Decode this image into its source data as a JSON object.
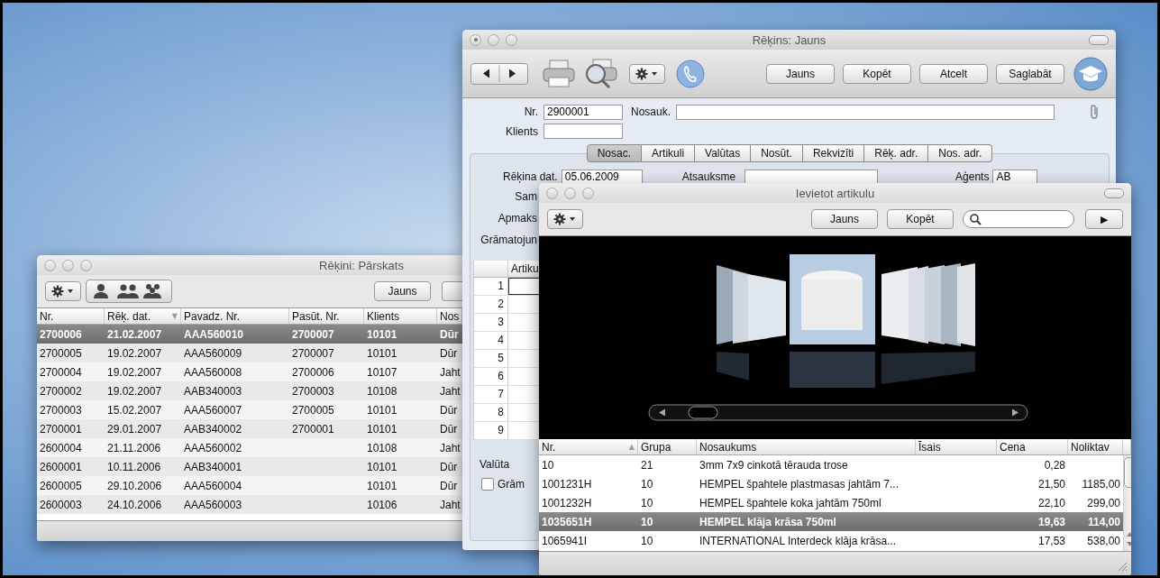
{
  "overview_window": {
    "title": "Rēķini: Pārskats",
    "buttons": [
      "Jauns"
    ],
    "columns": [
      {
        "label": "Nr."
      },
      {
        "label": "Rēķ. dat.",
        "sort_arrow": "▼"
      },
      {
        "label": "Pavadz. Nr."
      },
      {
        "label": "Pasūt. Nr."
      },
      {
        "label": "Klients"
      },
      {
        "label": "Nos"
      }
    ],
    "rows": [
      {
        "selected": true,
        "cells": [
          "2700006",
          "21.02.2007",
          "AAA560010",
          "2700007",
          "10101",
          "Dūr"
        ]
      },
      {
        "selected": false,
        "cells": [
          "2700005",
          "19.02.2007",
          "AAA560009",
          "2700007",
          "10101",
          "Dūr"
        ]
      },
      {
        "selected": false,
        "cells": [
          "2700004",
          "19.02.2007",
          "AAA560008",
          "2700006",
          "10107",
          "Jaht"
        ]
      },
      {
        "selected": false,
        "cells": [
          "2700002",
          "19.02.2007",
          "AAB340003",
          "2700003",
          "10108",
          "Jaht"
        ]
      },
      {
        "selected": false,
        "cells": [
          "2700003",
          "15.02.2007",
          "AAA560007",
          "2700005",
          "10101",
          "Dūr"
        ]
      },
      {
        "selected": false,
        "cells": [
          "2700001",
          "29.01.2007",
          "AAB340002",
          "2700001",
          "10101",
          "Dūr"
        ]
      },
      {
        "selected": false,
        "cells": [
          "2600004",
          "21.11.2006",
          "AAA560002",
          null,
          "10108",
          "Jaht"
        ]
      },
      {
        "selected": false,
        "cells": [
          "2600001",
          "10.11.2006",
          "AAB340001",
          null,
          "10101",
          "Dūr"
        ]
      },
      {
        "selected": false,
        "cells": [
          "2600005",
          "29.10.2006",
          "AAA560004",
          null,
          "10101",
          "Dūr"
        ]
      },
      {
        "selected": false,
        "cells": [
          "2600003",
          "24.10.2006",
          "AAA560003",
          null,
          "10106",
          "Jaht"
        ]
      }
    ]
  },
  "invoice_window": {
    "title": "Rēķins: Jauns",
    "unsaved": true,
    "buttons": [
      "Jauns",
      "Kopēt",
      "Atcelt",
      "Saglabāt"
    ],
    "nr": {
      "label": "Nr.",
      "value": "2900001"
    },
    "name": {
      "label": "Nosauk."
    },
    "client": {
      "label": "Klients"
    },
    "tabs": [
      {
        "label": "Nosac.",
        "selected": true
      },
      {
        "label": "Artikuli",
        "selected": false
      },
      {
        "label": "Valūtas",
        "selected": false
      },
      {
        "label": "Nosūt.",
        "selected": false
      },
      {
        "label": "Rekvizīti",
        "selected": false
      },
      {
        "label": "Rēķ. adr.",
        "selected": false
      },
      {
        "label": "Nos. adr.",
        "selected": false
      }
    ],
    "top_fields": [
      {
        "label": "Rēķina dat.",
        "value": "05.06.2009"
      },
      {
        "label": "Atsauksme"
      },
      {
        "label": "Aģents",
        "value": "AB"
      }
    ],
    "side_labels": [
      "Sam",
      "Apmaks",
      "Grāmatojun"
    ],
    "table": {
      "column": "Artiku",
      "rows": [
        "1",
        "2",
        "3",
        "4",
        "5",
        "6",
        "7",
        "8",
        "9"
      ]
    },
    "currency_label": "Valūta",
    "checkbox": {
      "label": "Grām",
      "checked": false
    }
  },
  "article_window": {
    "title": "Ievietot artikulu",
    "buttons": [
      "Jauns",
      "Kopēt"
    ],
    "play": "▶",
    "columns": [
      {
        "label": "Nr.",
        "sort_arrow": "▲"
      },
      {
        "label": "Grupa"
      },
      {
        "label": "Nosaukums"
      },
      {
        "label": "Īsais"
      },
      {
        "label": "Cena"
      },
      {
        "label": "Noliktav"
      }
    ],
    "rows": [
      {
        "selected": false,
        "cells": [
          "10",
          "21",
          "3mm 7x9 cinkotā tērauda trose",
          null,
          "0,28",
          null
        ]
      },
      {
        "selected": false,
        "cells": [
          "1001231H",
          "10",
          "HEMPEL špahtele plastmasas jahtām 7...",
          null,
          "21,50",
          "1185,00"
        ]
      },
      {
        "selected": false,
        "cells": [
          "1001232H",
          "10",
          "HEMPEL špahtele koka jahtām 750ml",
          null,
          "22,10",
          "299,00"
        ]
      },
      {
        "selected": true,
        "cells": [
          "1035651H",
          "10",
          "HEMPEL klāja krāsa 750ml",
          null,
          "19,63",
          "114,00"
        ]
      },
      {
        "selected": false,
        "cells": [
          "1065941I",
          "10",
          "INTERNATIONAL Interdeck klāja krāsa...",
          null,
          "17,53",
          "538,00"
        ]
      }
    ]
  }
}
